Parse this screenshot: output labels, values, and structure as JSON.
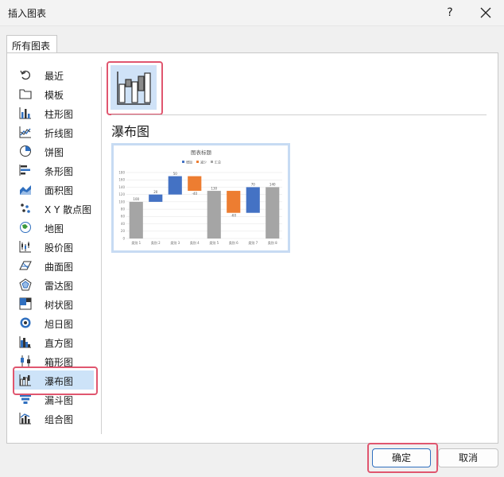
{
  "dialog": {
    "title": "插入图表",
    "help_label": "?"
  },
  "tabs": [
    {
      "label": "所有图表"
    }
  ],
  "nav": {
    "items": [
      {
        "label": "最近",
        "icon": "recent-icon"
      },
      {
        "label": "模板",
        "icon": "template-folder-icon"
      },
      {
        "label": "柱形图",
        "icon": "column-chart-icon"
      },
      {
        "label": "折线图",
        "icon": "line-chart-icon"
      },
      {
        "label": "饼图",
        "icon": "pie-chart-icon"
      },
      {
        "label": "条形图",
        "icon": "bar-chart-icon"
      },
      {
        "label": "面积图",
        "icon": "area-chart-icon"
      },
      {
        "label": "X Y 散点图",
        "icon": "scatter-chart-icon"
      },
      {
        "label": "地图",
        "icon": "map-chart-icon"
      },
      {
        "label": "股价图",
        "icon": "stock-chart-icon"
      },
      {
        "label": "曲面图",
        "icon": "surface-chart-icon"
      },
      {
        "label": "雷达图",
        "icon": "radar-chart-icon"
      },
      {
        "label": "树状图",
        "icon": "treemap-chart-icon"
      },
      {
        "label": "旭日图",
        "icon": "sunburst-chart-icon"
      },
      {
        "label": "直方图",
        "icon": "histogram-chart-icon"
      },
      {
        "label": "箱形图",
        "icon": "box-whisker-chart-icon"
      },
      {
        "label": "瀑布图",
        "icon": "waterfall-chart-icon"
      },
      {
        "label": "漏斗图",
        "icon": "funnel-chart-icon"
      },
      {
        "label": "组合图",
        "icon": "combo-chart-icon"
      }
    ],
    "selected_index": 16
  },
  "content": {
    "subtype_icon": "waterfall-chart-icon",
    "chart_name": "瀑布图"
  },
  "chart_data": {
    "type": "bar",
    "title": "图表标题",
    "legend": [
      {
        "name": "增加",
        "color": "#4472c4"
      },
      {
        "name": "减少",
        "color": "#ed7d31"
      },
      {
        "name": "汇总",
        "color": "#a5a5a5"
      }
    ],
    "legend_position": "top",
    "categories": [
      "类别 1",
      "类别 2",
      "类别 3",
      "类别 4",
      "类别 5",
      "类别 6",
      "类别 7",
      "类别 8"
    ],
    "values": [
      100,
      20,
      50,
      -40,
      130,
      -60,
      70,
      140
    ],
    "kinds": [
      "total",
      "increase",
      "increase",
      "decrease",
      "total",
      "decrease",
      "increase",
      "total"
    ],
    "data_labels": [
      "100",
      "20",
      "50",
      "-40",
      "130",
      "-60",
      "70",
      "140"
    ],
    "yticks": [
      "0",
      "20",
      "40",
      "60",
      "80",
      "100",
      "120",
      "140",
      "160",
      "180"
    ],
    "ylim": [
      0,
      180
    ],
    "grid": true
  },
  "buttons": {
    "ok_label": "确定",
    "cancel_label": "取消"
  },
  "colors": {
    "selected_bg": "#cde3f8",
    "highlight": "#e0566f",
    "increase": "#4472c4",
    "decrease": "#ed7d31",
    "total": "#a5a5a5"
  }
}
